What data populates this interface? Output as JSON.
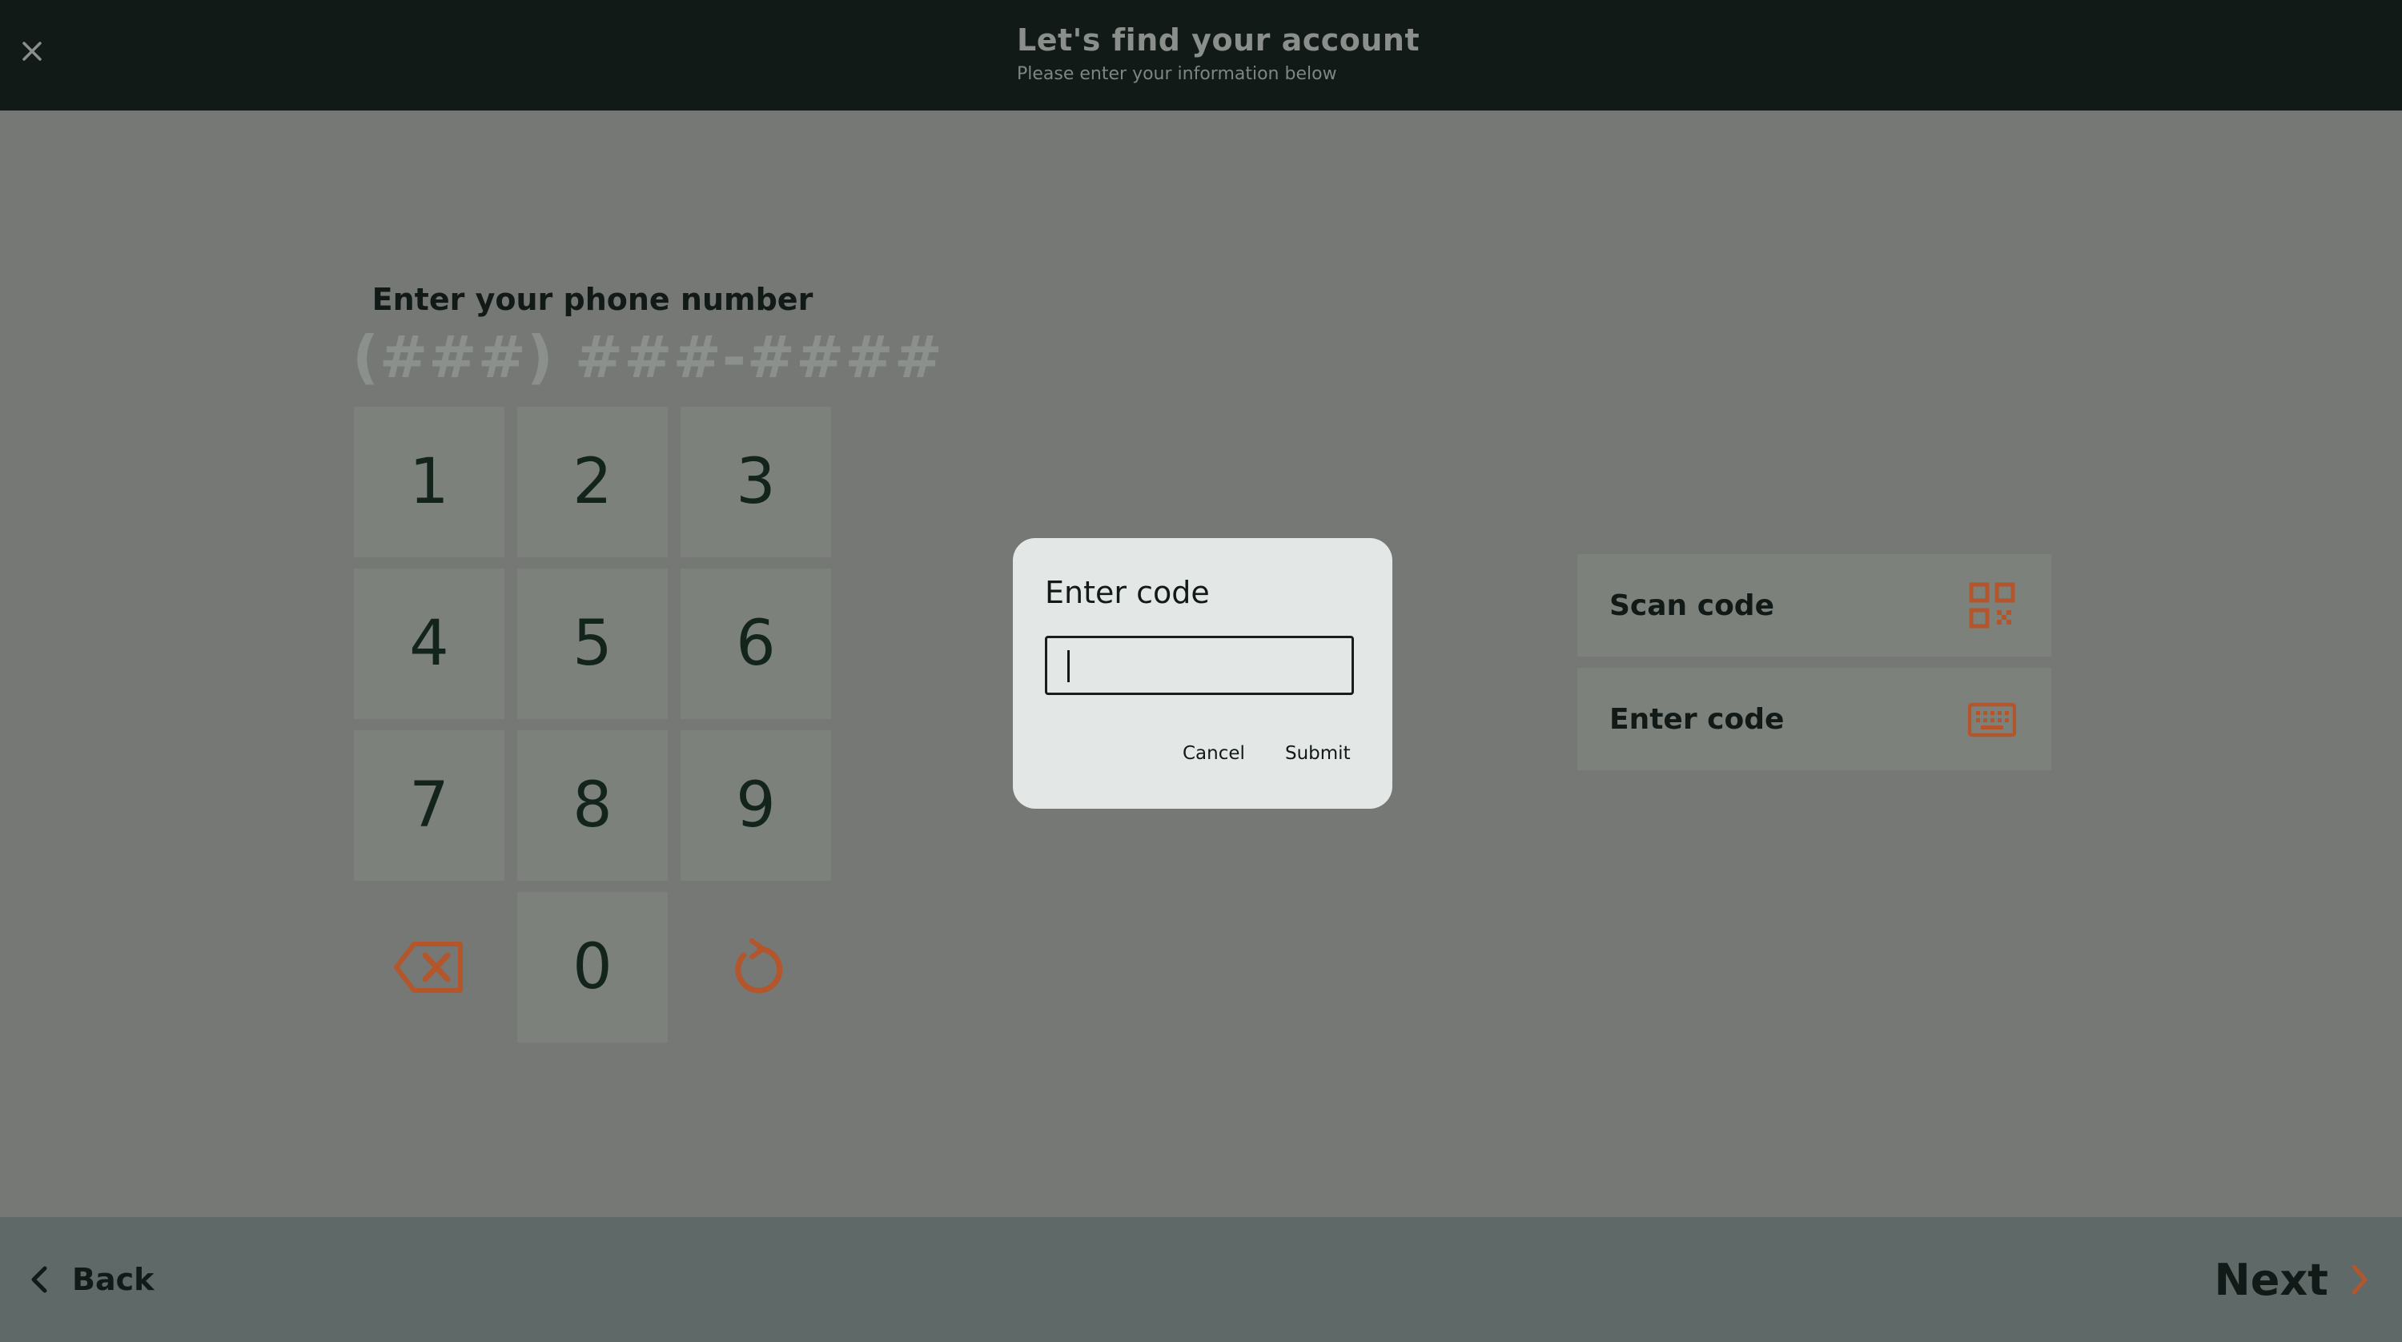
{
  "header": {
    "title": "Let's find your account",
    "subtitle": "Please enter your information below"
  },
  "phone": {
    "label": "Enter your phone number",
    "placeholder": "(###) ###-####"
  },
  "keypad": {
    "keys": [
      "1",
      "2",
      "3",
      "4",
      "5",
      "6",
      "7",
      "8",
      "9",
      "0"
    ]
  },
  "options": {
    "scan_label": "Scan code",
    "enter_label": "Enter code"
  },
  "dialog": {
    "title": "Enter code",
    "input_value": "",
    "cancel_label": "Cancel",
    "submit_label": "Submit"
  },
  "footer": {
    "back_label": "Back",
    "next_label": "Next"
  },
  "colors": {
    "header_bg": "#111a17",
    "accent": "#b3562c",
    "overlay_bg": "#757875",
    "key_bg": "#7d817c",
    "footer_bg": "#5f6968",
    "dialog_bg": "#e3e8e7"
  },
  "icons": {
    "close": "close-icon",
    "backspace": "backspace-icon",
    "reset": "reset-icon",
    "qr": "qr-code-icon",
    "keyboard": "keyboard-icon",
    "back": "chevron-left-icon",
    "next": "chevron-right-icon"
  }
}
